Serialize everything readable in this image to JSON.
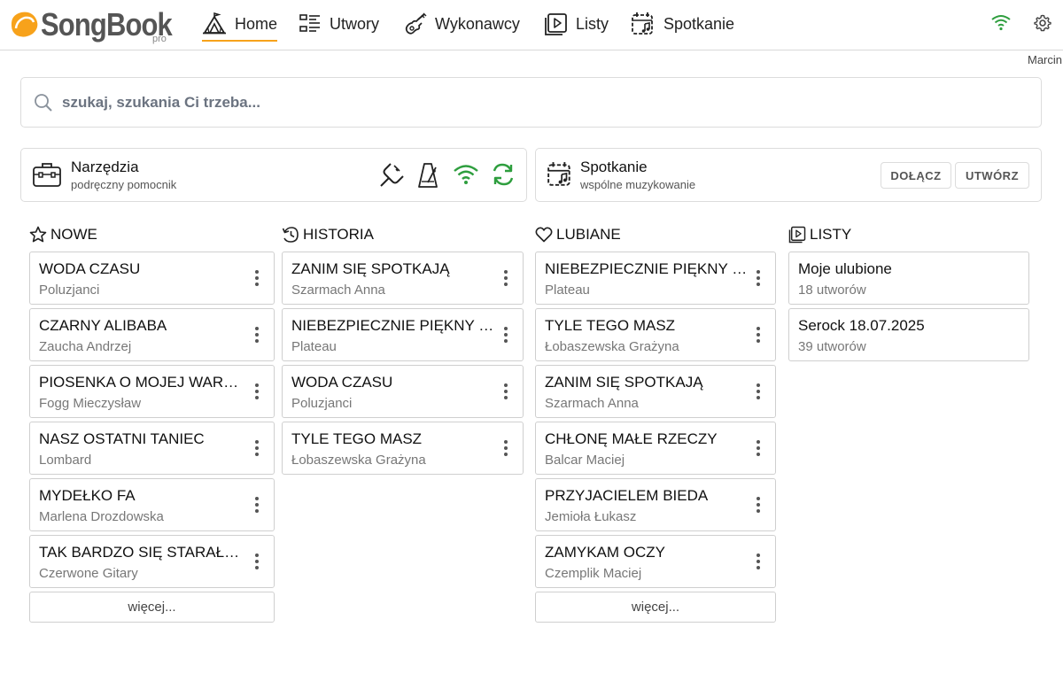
{
  "brand": {
    "name": "SongBook",
    "suffix": "pro",
    "accent": "#f7a21b"
  },
  "nav": {
    "items": [
      {
        "label": "Home",
        "icon": "circus-tent-icon",
        "active": true
      },
      {
        "label": "Utwory",
        "icon": "list-icon"
      },
      {
        "label": "Wykonawcy",
        "icon": "guitar-icon"
      },
      {
        "label": "Listy",
        "icon": "playlist-icon"
      },
      {
        "label": "Spotkanie",
        "icon": "calendar-music-icon"
      }
    ],
    "user": "Marcin",
    "status_color": "#2e9e3e"
  },
  "search": {
    "placeholder": "szukaj, szukania Ci trzeba..."
  },
  "tools": {
    "title": "Narzędzia",
    "subtitle": "podręczny pomocnik",
    "icons": [
      "tuning-fork-icon",
      "metronome-icon",
      "wifi-icon",
      "sync-icon"
    ]
  },
  "meeting": {
    "title": "Spotkanie",
    "subtitle": "wspólne muzykowanie",
    "join_label": "DOŁĄCZ",
    "create_label": "UTWÓRZ"
  },
  "columns": {
    "nowe": {
      "heading": "NOWE",
      "more_label": "więcej...",
      "items": [
        {
          "title": "WODA CZASU",
          "artist": "Poluzjanci"
        },
        {
          "title": "CZARNY ALIBABA",
          "artist": "Zaucha Andrzej"
        },
        {
          "title": "PIOSENKA O MOJEJ WARSZAWIE",
          "artist": "Fogg Mieczysław"
        },
        {
          "title": "NASZ OSTATNI TANIEC",
          "artist": "Lombard"
        },
        {
          "title": "MYDEŁKO FA",
          "artist": "Marlena Drozdowska"
        },
        {
          "title": "TAK BARDZO SIĘ STARAŁEM",
          "artist": "Czerwone Gitary"
        }
      ]
    },
    "historia": {
      "heading": "HISTORIA",
      "items": [
        {
          "title": "ZANIM SIĘ SPOTKAJĄ",
          "artist": "Szarmach Anna"
        },
        {
          "title": "NIEBEZPIECZNIE PIĘKNY ŚWIAT",
          "artist": "Plateau"
        },
        {
          "title": "WODA CZASU",
          "artist": "Poluzjanci"
        },
        {
          "title": "TYLE TEGO MASZ",
          "artist": "Łobaszewska Grażyna"
        }
      ]
    },
    "lubiane": {
      "heading": "LUBIANE",
      "more_label": "więcej...",
      "items": [
        {
          "title": "NIEBEZPIECZNIE PIĘKNY ŚWIAT",
          "artist": "Plateau"
        },
        {
          "title": "TYLE TEGO MASZ",
          "artist": "Łobaszewska Grażyna"
        },
        {
          "title": "ZANIM SIĘ SPOTKAJĄ",
          "artist": "Szarmach Anna"
        },
        {
          "title": "CHŁONĘ MAŁE RZECZY",
          "artist": "Balcar Maciej"
        },
        {
          "title": "PRZYJACIELEM BIEDA",
          "artist": "Jemioła Łukasz"
        },
        {
          "title": "ZAMYKAM OCZY",
          "artist": "Czemplik Maciej"
        }
      ]
    },
    "listy": {
      "heading": "LISTY",
      "items": [
        {
          "title": "Moje ulubione",
          "count": "18 utworów"
        },
        {
          "title": "Serock 18.07.2025",
          "count": "39 utworów"
        }
      ]
    }
  }
}
